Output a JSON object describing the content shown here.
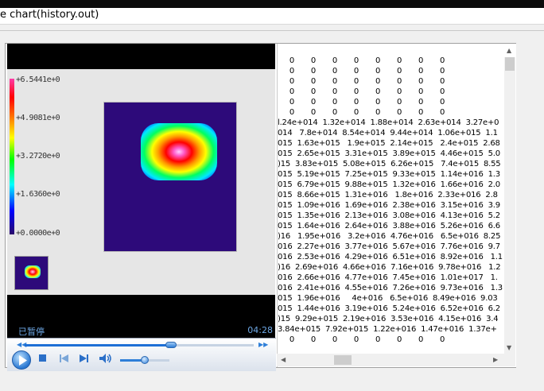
{
  "window": {
    "title": "e chart(history.out)"
  },
  "player": {
    "colorbar_labels": [
      "+6.5441e+0",
      "+4.9081e+0",
      "+3.2720e+0",
      "+1.6360e+0",
      "+0.0000e+0"
    ],
    "status": "已暂停",
    "time": "04:28",
    "progress_fraction": 0.64,
    "volume_fraction": 0.5
  },
  "output": {
    "lines": [
      "     0       0       0       0       0       0       0       0",
      "     0       0       0       0       0       0       0       0",
      "     0       0       0       0       0       0       0       0",
      "     0       0       0       0       0       0       0       0",
      "     0       0       0       0       0       0       0       0",
      "     0       0       0       0       0       0       0       0",
      "l.24e+014  1.32e+014  1.88e+014  2.63e+014  3.27e+0",
      "014   7.8e+014  8.54e+014  9.44e+014  1.06e+015  1.1",
      "015  1.63e+015   1.9e+015  2.14e+015   2.4e+015  2.68",
      "015  2.65e+015  3.31e+015  3.89e+015  4.46e+015  5.0",
      ")15  3.83e+015  5.08e+015  6.26e+015   7.4e+015  8.55",
      "015  5.19e+015  7.25e+015  9.33e+015  1.14e+016  1.3",
      "015  6.79e+015  9.88e+015  1.32e+016  1.66e+016  2.0",
      "015  8.66e+015  1.31e+016   1.8e+016  2.33e+016  2.8",
      "015  1.09e+016  1.69e+016  2.38e+016  3.15e+016  3.9",
      "015  1.35e+016  2.13e+016  3.08e+016  4.13e+016  5.2",
      "015  1.64e+016  2.64e+016  3.88e+016  5.26e+016  6.6",
      ")16   1.95e+016   3.2e+016  4.76e+016   6.5e+016  8.25",
      "016  2.27e+016  3.77e+016  5.67e+016  7.76e+016  9.7",
      "016  2.53e+016  4.29e+016  6.51e+016  8.92e+016   1.1",
      ")16  2.69e+016  4.66e+016  7.16e+016  9.78e+016   1.2",
      "016  2.66e+016  4.77e+016  7.45e+016  1.01e+017   1.",
      "016  2.41e+016  4.55e+016  7.26e+016  9.73e+016   1.3",
      "015  1.96e+016     4e+016   6.5e+016  8.49e+016  9.03",
      "015  1.44e+016  3.19e+016  5.24e+016  6.52e+016  6.2",
      ")15  9.29e+015  2.19e+016  3.53e+016  4.15e+016  3.4",
      "3.84e+015  7.92e+015  1.22e+016  1.47e+016  1.37e+",
      "     0       0       0       0       0       0       0       0"
    ]
  }
}
